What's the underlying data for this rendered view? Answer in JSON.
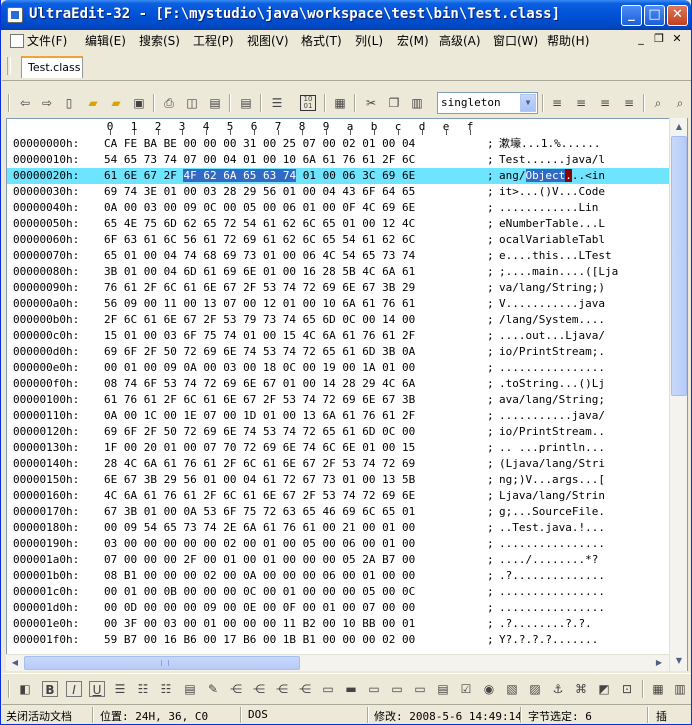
{
  "window": {
    "title": "UltraEdit-32 - [F:\\mystudio\\java\\workspace\\test\\bin\\Test.class]",
    "min": "_",
    "max": "□",
    "close": "✕"
  },
  "menu": [
    {
      "label": "文件(F)"
    },
    {
      "label": "编辑(E)"
    },
    {
      "label": "搜索(S)"
    },
    {
      "label": "工程(P)"
    },
    {
      "label": "视图(V)"
    },
    {
      "label": "格式(T)"
    },
    {
      "label": "列(L)"
    },
    {
      "label": "宏(M)"
    },
    {
      "label": "高级(A)"
    },
    {
      "label": "窗口(W)"
    },
    {
      "label": "帮助(H)"
    }
  ],
  "mdi": {
    "min": "_",
    "restore": "❐",
    "close": "✕"
  },
  "tab": {
    "label": "Test.class"
  },
  "toolbar": {
    "font": "singleton"
  },
  "ruler": [
    "0",
    "1",
    "2",
    "3",
    "4",
    "5",
    "6",
    "7",
    "8",
    "9",
    "a",
    "b",
    "c",
    "d",
    "e",
    "f"
  ],
  "rows": [
    {
      "addr": "00000000h:",
      "hex": "CA FE BA BE 00 00 00 31 00 25 07 00 02 01 00 04",
      "ascii": "漱壕...1.%......"
    },
    {
      "addr": "00000010h:",
      "hex": "54 65 73 74 07 00 04 01 00 10 6A 61 76 61 2F 6C",
      "ascii": "Test......java/l"
    },
    {
      "addr": "00000020h:",
      "hex_pre": "61 6E 67 2F ",
      "hex_sel": "4F 62 6A 65 63 74",
      "hex_post": " 01 00 06 3C 69 6E",
      "ascii_pre": "ang/",
      "ascii_sel": "Object",
      "ascii_caret": ".",
      "ascii_post": "..<in",
      "highlight": true
    },
    {
      "addr": "00000030h:",
      "hex": "69 74 3E 01 00 03 28 29 56 01 00 04 43 6F 64 65",
      "ascii": "it>...()V...Code"
    },
    {
      "addr": "00000040h:",
      "hex": "0A 00 03 00 09 0C 00 05 00 06 01 00 0F 4C 69 6E",
      "ascii": "............Lin"
    },
    {
      "addr": "00000050h:",
      "hex": "65 4E 75 6D 62 65 72 54 61 62 6C 65 01 00 12 4C",
      "ascii": "eNumberTable...L"
    },
    {
      "addr": "00000060h:",
      "hex": "6F 63 61 6C 56 61 72 69 61 62 6C 65 54 61 62 6C",
      "ascii": "ocalVariableTabl"
    },
    {
      "addr": "00000070h:",
      "hex": "65 01 00 04 74 68 69 73 01 00 06 4C 54 65 73 74",
      "ascii": "e....this...LTest"
    },
    {
      "addr": "00000080h:",
      "hex": "3B 01 00 04 6D 61 69 6E 01 00 16 28 5B 4C 6A 61",
      "ascii": ";....main....([Lja"
    },
    {
      "addr": "00000090h:",
      "hex": "76 61 2F 6C 61 6E 67 2F 53 74 72 69 6E 67 3B 29",
      "ascii": "va/lang/String;)"
    },
    {
      "addr": "000000a0h:",
      "hex": "56 09 00 11 00 13 07 00 12 01 00 10 6A 61 76 61",
      "ascii": "V...........java"
    },
    {
      "addr": "000000b0h:",
      "hex": "2F 6C 61 6E 67 2F 53 79 73 74 65 6D 0C 00 14 00",
      "ascii": "/lang/System...."
    },
    {
      "addr": "000000c0h:",
      "hex": "15 01 00 03 6F 75 74 01 00 15 4C 6A 61 76 61 2F",
      "ascii": "....out...Ljava/"
    },
    {
      "addr": "000000d0h:",
      "hex": "69 6F 2F 50 72 69 6E 74 53 74 72 65 61 6D 3B 0A",
      "ascii": "io/PrintStream;."
    },
    {
      "addr": "000000e0h:",
      "hex": "00 01 00 09 0A 00 03 00 18 0C 00 19 00 1A 01 00",
      "ascii": "................"
    },
    {
      "addr": "000000f0h:",
      "hex": "08 74 6F 53 74 72 69 6E 67 01 00 14 28 29 4C 6A",
      "ascii": ".toString...()Lj"
    },
    {
      "addr": "00000100h:",
      "hex": "61 76 61 2F 6C 61 6E 67 2F 53 74 72 69 6E 67 3B",
      "ascii": "ava/lang/String;"
    },
    {
      "addr": "00000110h:",
      "hex": "0A 00 1C 00 1E 07 00 1D 01 00 13 6A 61 76 61 2F",
      "ascii": "...........java/"
    },
    {
      "addr": "00000120h:",
      "hex": "69 6F 2F 50 72 69 6E 74 53 74 72 65 61 6D 0C 00",
      "ascii": "io/PrintStream.."
    },
    {
      "addr": "00000130h:",
      "hex": "1F 00 20 01 00 07 70 72 69 6E 74 6C 6E 01 00 15",
      "ascii": ".. ...println..."
    },
    {
      "addr": "00000140h:",
      "hex": "28 4C 6A 61 76 61 2F 6C 61 6E 67 2F 53 74 72 69",
      "ascii": "(Ljava/lang/Stri"
    },
    {
      "addr": "00000150h:",
      "hex": "6E 67 3B 29 56 01 00 04 61 72 67 73 01 00 13 5B",
      "ascii": "ng;)V...args...["
    },
    {
      "addr": "00000160h:",
      "hex": "4C 6A 61 76 61 2F 6C 61 6E 67 2F 53 74 72 69 6E",
      "ascii": "Ljava/lang/Strin"
    },
    {
      "addr": "00000170h:",
      "hex": "67 3B 01 00 0A 53 6F 75 72 63 65 46 69 6C 65 01",
      "ascii": "g;...SourceFile."
    },
    {
      "addr": "00000180h:",
      "hex": "00 09 54 65 73 74 2E 6A 61 76 61 00 21 00 01 00",
      "ascii": "..Test.java.!..."
    },
    {
      "addr": "00000190h:",
      "hex": "03 00 00 00 00 00 02 00 01 00 05 00 06 00 01 00",
      "ascii": "................"
    },
    {
      "addr": "000001a0h:",
      "hex": "07 00 00 00 2F 00 01 00 01 00 00 00 05 2A B7 00",
      "ascii": "..../........*?"
    },
    {
      "addr": "000001b0h:",
      "hex": "08 B1 00 00 00 02 00 0A 00 00 00 06 00 01 00 00",
      "ascii": ".?.............."
    },
    {
      "addr": "000001c0h:",
      "hex": "00 01 00 0B 00 00 00 0C 00 01 00 00 00 05 00 0C",
      "ascii": "................"
    },
    {
      "addr": "000001d0h:",
      "hex": "00 0D 00 00 00 09 00 0E 00 0F 00 01 00 07 00 00",
      "ascii": "................"
    },
    {
      "addr": "000001e0h:",
      "hex": "00 3F 00 03 00 01 00 00 00 11 B2 00 10 BB 00 01",
      "ascii": ".?........?.?."
    },
    {
      "addr": "000001f0h:",
      "hex": "59 B7 00 16 B6 00 17 B6 00 1B B1 00 00 00 02 00",
      "ascii": "Y?.?.?.?......."
    }
  ],
  "status": {
    "activate": "关闭活动文档",
    "position": "位置: 24H, 36, C0",
    "format": "DOS",
    "modified": "修改: 2008-5-6 14:49:14",
    "selected": "字节选定: 6",
    "mode": "插"
  }
}
